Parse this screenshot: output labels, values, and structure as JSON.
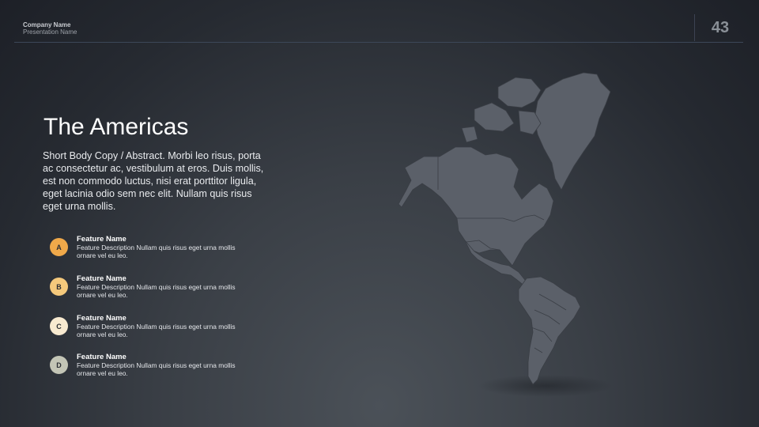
{
  "header": {
    "company": "Company Name",
    "presentation": "Presentation Name",
    "page_number": "43"
  },
  "slide": {
    "title": "The Americas",
    "body": "Short Body Copy / Abstract.  Morbi leo risus, porta ac consectetur ac, vestibulum at eros. Duis mollis, est non commodo luctus, nisi erat porttitor ligula, eget lacinia odio sem nec elit. Nullam quis risus eget urna mollis."
  },
  "features": [
    {
      "letter": "A",
      "name": "Feature Name",
      "description": "Feature Description Nullam quis risus eget urna mollis ornare vel eu leo.",
      "color": "#f0a94a"
    },
    {
      "letter": "B",
      "name": "Feature Name",
      "description": "Feature Description Nullam quis risus eget urna mollis ornare vel eu leo.",
      "color": "#f5c97c"
    },
    {
      "letter": "C",
      "name": "Feature Name",
      "description": "Feature Description Nullam quis risus eget urna mollis ornare vel eu leo.",
      "color": "#f8ead0"
    },
    {
      "letter": "D",
      "name": "Feature Name",
      "description": "Feature Description Nullam quis risus eget urna mollis ornare vel eu leo.",
      "color": "#c3c5b6"
    }
  ],
  "map": {
    "fill_color": "#5b6069",
    "border_color": "#3a3e45"
  }
}
